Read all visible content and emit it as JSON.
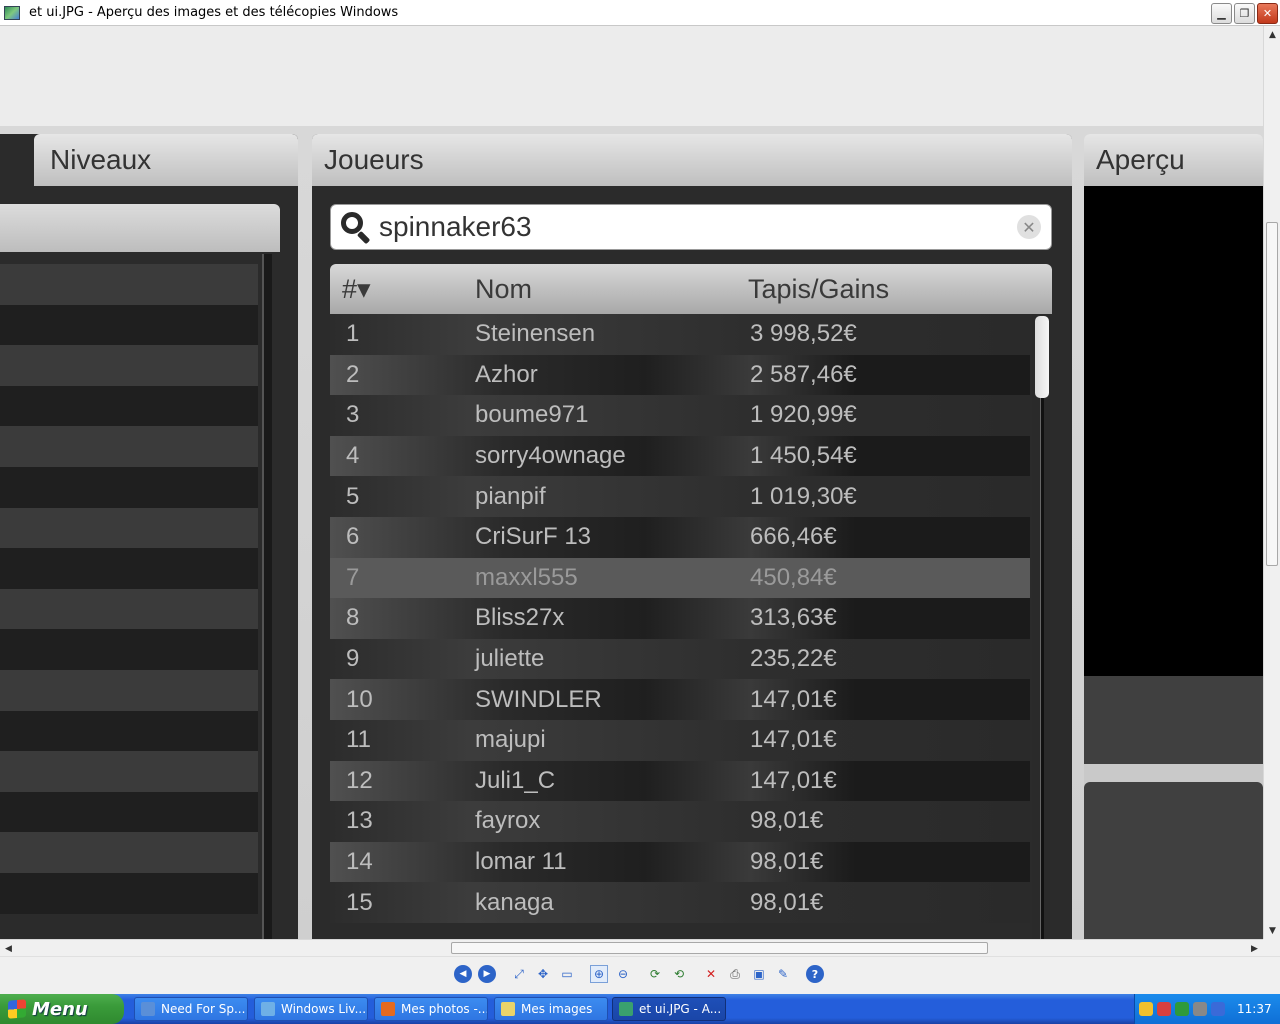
{
  "window": {
    "title": "et ui.JPG - Aperçu des images et des télécopies Windows",
    "minimize": "▁",
    "maximize": "❐",
    "close": "✕"
  },
  "left_panel": {
    "tab_label": "Niveaux"
  },
  "center_panel": {
    "header": "Joueurs",
    "search": {
      "value": "spinnaker63",
      "clear_glyph": "✕"
    },
    "table": {
      "columns": [
        "#▾",
        "Nom",
        "Tapis/Gains"
      ],
      "rows": [
        {
          "rank": "1",
          "name": "Steinensen",
          "amount": "3 998,52€"
        },
        {
          "rank": "2",
          "name": "Azhor",
          "amount": "2 587,46€"
        },
        {
          "rank": "3",
          "name": "boume971",
          "amount": "1 920,99€"
        },
        {
          "rank": "4",
          "name": "sorry4ownage",
          "amount": "1 450,54€"
        },
        {
          "rank": "5",
          "name": "pianpif",
          "amount": "1 019,30€"
        },
        {
          "rank": "6",
          "name": "CriSurF 13",
          "amount": "666,46€"
        },
        {
          "rank": "7",
          "name": "maxxl555",
          "amount": "450,84€"
        },
        {
          "rank": "8",
          "name": "Bliss27x",
          "amount": "313,63€"
        },
        {
          "rank": "9",
          "name": "juliette",
          "amount": "235,22€"
        },
        {
          "rank": "10",
          "name": "SWINDLER",
          "amount": "147,01€"
        },
        {
          "rank": "11",
          "name": "majupi",
          "amount": "147,01€"
        },
        {
          "rank": "12",
          "name": "Juli1_C",
          "amount": "147,01€"
        },
        {
          "rank": "13",
          "name": "fayrox",
          "amount": "98,01€"
        },
        {
          "rank": "14",
          "name": "lomar 11",
          "amount": "98,01€"
        },
        {
          "rank": "15",
          "name": "kanaga",
          "amount": "98,01€"
        }
      ]
    }
  },
  "right_panel": {
    "header": "Aperçu"
  },
  "toolbar": {
    "buttons": [
      {
        "name": "previous-image-button",
        "icon": "◀"
      },
      {
        "name": "next-image-button",
        "icon": "▶"
      },
      {
        "name": "best-fit-button",
        "icon": "⤢"
      },
      {
        "name": "actual-size-button",
        "icon": "✥"
      },
      {
        "name": "slideshow-button",
        "icon": "▭"
      },
      {
        "name": "zoom-in-button",
        "icon": "⊕"
      },
      {
        "name": "zoom-out-button",
        "icon": "⊖"
      },
      {
        "name": "rotate-clockwise-button",
        "icon": "⟳"
      },
      {
        "name": "rotate-counterclockwise-button",
        "icon": "⟲"
      },
      {
        "name": "delete-button",
        "icon": "✕"
      },
      {
        "name": "print-button",
        "icon": "⎙"
      },
      {
        "name": "save-button",
        "icon": "▣"
      },
      {
        "name": "edit-button",
        "icon": "✎"
      },
      {
        "name": "help-button",
        "icon": "?"
      }
    ]
  },
  "taskbar": {
    "start_label": "Menu",
    "tasks": [
      {
        "label": "Need For Sp...",
        "color": "#5a8fd8"
      },
      {
        "label": "Windows Liv...",
        "color": "#6fb0e6"
      },
      {
        "label": "Mes photos -...",
        "color": "#e46a1f"
      },
      {
        "label": "Mes images",
        "color": "#e9d46a"
      },
      {
        "label": "et ui.JPG - A...",
        "color": "#3aa06e"
      }
    ],
    "clock": "11:37"
  }
}
